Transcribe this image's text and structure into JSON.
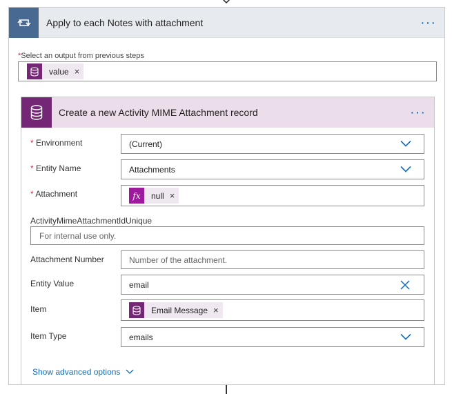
{
  "loop": {
    "title": "Apply to each Notes with attachment",
    "more_label": "···",
    "select_label": "Select an output from previous steps",
    "select_required_marker": "*",
    "select_token": "value",
    "token_remove": "×"
  },
  "action": {
    "title": "Create a new Activity MIME Attachment record",
    "more_label": "···",
    "fields": {
      "environment": {
        "label": "Environment",
        "required": "*",
        "value": "(Current)"
      },
      "entity_name": {
        "label": "Entity Name",
        "required": "*",
        "value": "Attachments"
      },
      "attachment": {
        "label": "Attachment",
        "required": "*",
        "token": "null",
        "fx": "fx"
      },
      "unique_id": {
        "label": "ActivityMimeAttachmentIdUnique",
        "placeholder": "For internal use only."
      },
      "attachment_number": {
        "label": "Attachment Number",
        "placeholder": "Number of the attachment."
      },
      "entity_value": {
        "label": "Entity Value",
        "value": "email"
      },
      "item": {
        "label": "Item",
        "token": "Email Message"
      },
      "item_type": {
        "label": "Item Type",
        "value": "emails"
      }
    },
    "token_remove": "×",
    "show_advanced": "Show advanced options"
  },
  "colors": {
    "loop_header": "#e7eaee",
    "loop_icon_bg": "#486991",
    "action_header": "#ebdde9",
    "dataverse_purple": "#742774",
    "link_blue": "#0f6cbd"
  },
  "icons": {
    "loop": "loop-icon",
    "database": "database-icon",
    "chevron": "chevron-down-icon",
    "clear": "close-icon"
  }
}
